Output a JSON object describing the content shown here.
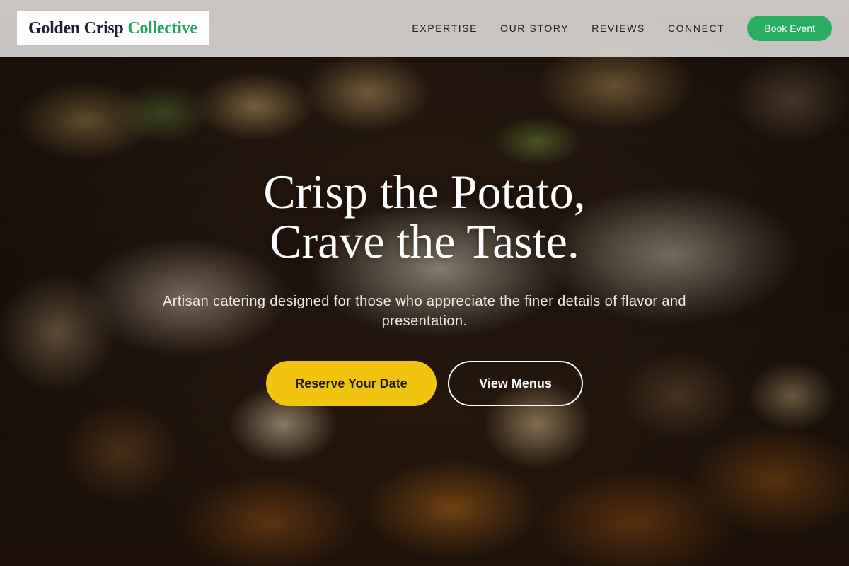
{
  "brand": {
    "name_part1": "Golden Crisp",
    "name_part2": "Collective",
    "accent_color": "#22a55a"
  },
  "nav": {
    "items": [
      {
        "label": "EXPERTISE"
      },
      {
        "label": "OUR STORY"
      },
      {
        "label": "REVIEWS"
      },
      {
        "label": "CONNECT"
      }
    ],
    "cta_label": "Book Event"
  },
  "hero": {
    "headline_line1": "Crisp the Potato,",
    "headline_line2": "Crave the Taste.",
    "subtext": "Artisan catering designed for those who appreciate the finer details of flavor and presentation.",
    "primary_button": "Reserve Your Date",
    "secondary_button": "View Menus",
    "primary_color": "#f1c410",
    "cta_color": "#27ae60"
  }
}
